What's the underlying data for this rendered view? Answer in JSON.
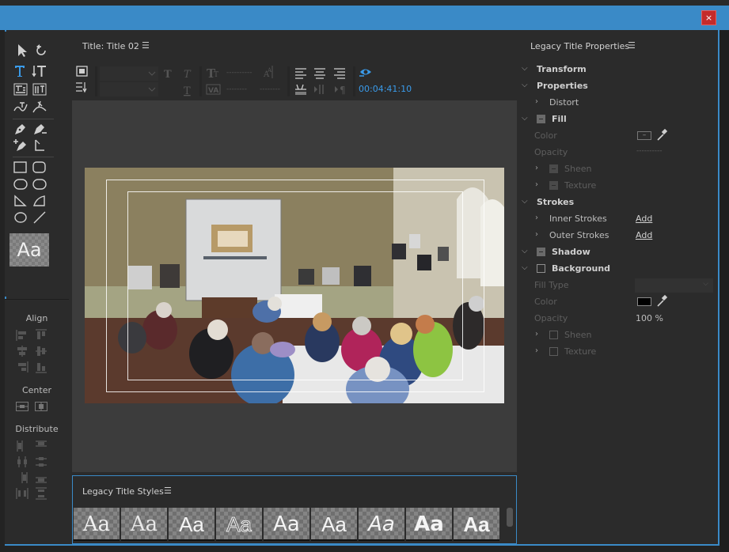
{
  "window": {
    "close_label": "×"
  },
  "title_panel": {
    "title": "Title: Title 02",
    "timecode": "00:04:41:10"
  },
  "tools": {
    "preview_label": "Aa"
  },
  "align_panel": {
    "align_label": "Align",
    "center_label": "Center",
    "distribute_label": "Distribute"
  },
  "styles_panel": {
    "title": "Legacy Title Styles",
    "swatches": [
      "Aa",
      "Aa",
      "Aa",
      "Aa",
      "Aa",
      "Aa",
      "Aa",
      "Aa",
      "Aa"
    ]
  },
  "properties": {
    "title": "Legacy Title Properties",
    "transform": "Transform",
    "properties": "Properties",
    "distort": "Distort",
    "fill": "Fill",
    "fill_color": "Color",
    "fill_opacity": "Opacity",
    "fill_opacity_value": "----------",
    "fill_sheen": "Sheen",
    "fill_texture": "Texture",
    "strokes": "Strokes",
    "inner_strokes": "Inner Strokes",
    "outer_strokes": "Outer Strokes",
    "add_label": "Add",
    "shadow": "Shadow",
    "background": "Background",
    "bg_fill_type": "Fill Type",
    "bg_color": "Color",
    "bg_color_value": "#000000",
    "bg_opacity": "Opacity",
    "bg_opacity_value": "100 %",
    "bg_sheen": "Sheen",
    "bg_texture": "Texture"
  },
  "toolbar": {
    "dash1": "----------",
    "dash2": "--------",
    "dash3": "--------"
  }
}
